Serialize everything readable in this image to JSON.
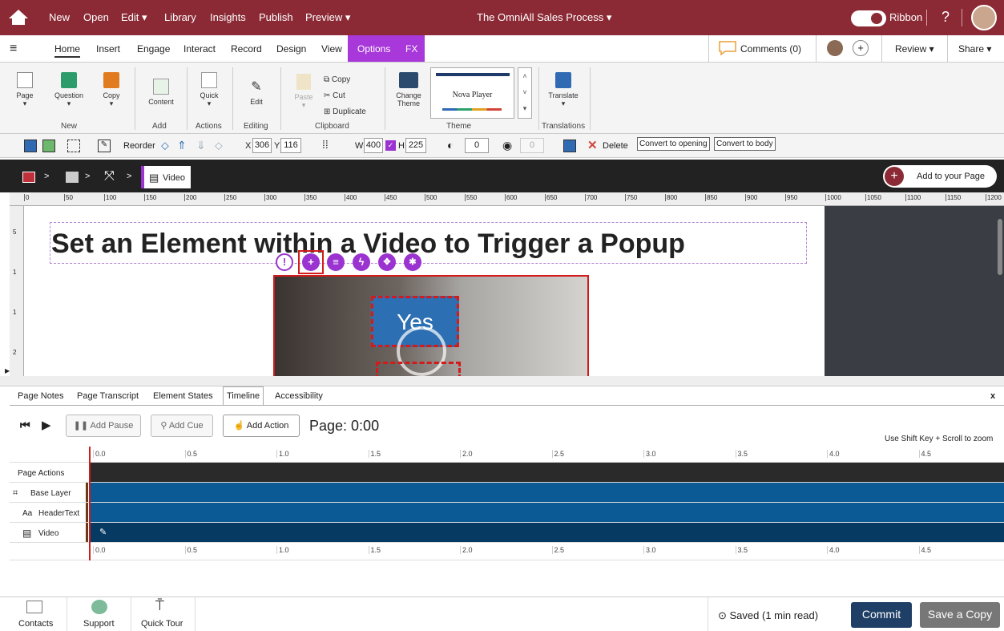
{
  "topbar": {
    "menu": [
      "New",
      "Open",
      "Edit ▾",
      "Library",
      "Insights",
      "Publish",
      "Preview ▾"
    ],
    "doc_title": "The OmniAll Sales Process ▾",
    "ribbon_label": "Ribbon",
    "help": "?"
  },
  "tabs": {
    "items": [
      "Home",
      "Insert",
      "Engage",
      "Interact",
      "Record",
      "Design",
      "View"
    ],
    "options": "Options",
    "fx": "FX",
    "comments": "Comments (0)",
    "plus": "+",
    "review": "Review ▾",
    "share": "Share ▾"
  },
  "ribbon": {
    "buttons": [
      "Page",
      "Question",
      "Copy",
      "Content",
      "Quick",
      "Edit",
      "Paste",
      "Change Theme",
      "Translate"
    ],
    "clipboard": [
      "Copy",
      "Cut",
      "Duplicate"
    ],
    "theme_name": "Nova Player",
    "groups": [
      "New",
      "Add",
      "Actions",
      "Editing",
      "Clipboard",
      "Theme",
      "Translations"
    ]
  },
  "toolbar": {
    "reorder": "Reorder",
    "x_label": "X",
    "x": "306",
    "y_label": "Y",
    "y": "116",
    "w_label": "W",
    "w": "400",
    "h_label": "H",
    "h": "225",
    "opacity": "0",
    "rotate": "0",
    "delete": "Delete",
    "convert_open": "Convert to opening",
    "convert_body": "Convert to body"
  },
  "crumb": {
    "current": "Video",
    "add": "Add to your Page",
    "sep": ">"
  },
  "ruler": {
    "marks": [
      "0",
      "50",
      "100",
      "150",
      "200",
      "250",
      "300",
      "350",
      "400",
      "450",
      "500",
      "550",
      "600",
      "650",
      "700",
      "750",
      "800",
      "850",
      "900",
      "950",
      "1000",
      "1050",
      "1100",
      "1150",
      "1200"
    ],
    "vmarks": [
      "5",
      "1",
      "1",
      "2"
    ]
  },
  "canvas": {
    "heading": "Set an Element within a Video to Trigger a Popup",
    "yes": "Yes"
  },
  "panel": {
    "tabs": [
      "Page Notes",
      "Page Transcript",
      "Element States",
      "Timeline",
      "Accessibility"
    ],
    "close": "x"
  },
  "tl_controls": {
    "add_pause": "Add Pause",
    "add_cue": "Add Cue",
    "add_action": "Add Action",
    "page_time": "Page: 0:00",
    "hint": "Use Shift Key + Scroll to zoom"
  },
  "timeline": {
    "ticks": [
      "0.0",
      "0.5",
      "1.0",
      "1.5",
      "2.0",
      "2.5",
      "3.0",
      "3.5",
      "4.0",
      "4.5"
    ],
    "rows": [
      "Page Actions",
      "Base Layer",
      "HeaderText",
      "Video"
    ],
    "row_icons": [
      "",
      "⌗",
      "Aa",
      "▤"
    ]
  },
  "footer": {
    "contacts": "Contacts",
    "support": "Support",
    "tour": "Quick Tour",
    "saved": "Saved (1 min read)",
    "commit": "Commit",
    "save_copy": "Save a Copy"
  },
  "colors": {
    "brand": "#8b2a35",
    "purple": "#9a33d0",
    "commit": "#1f3f66",
    "track": "#0b5a95"
  }
}
